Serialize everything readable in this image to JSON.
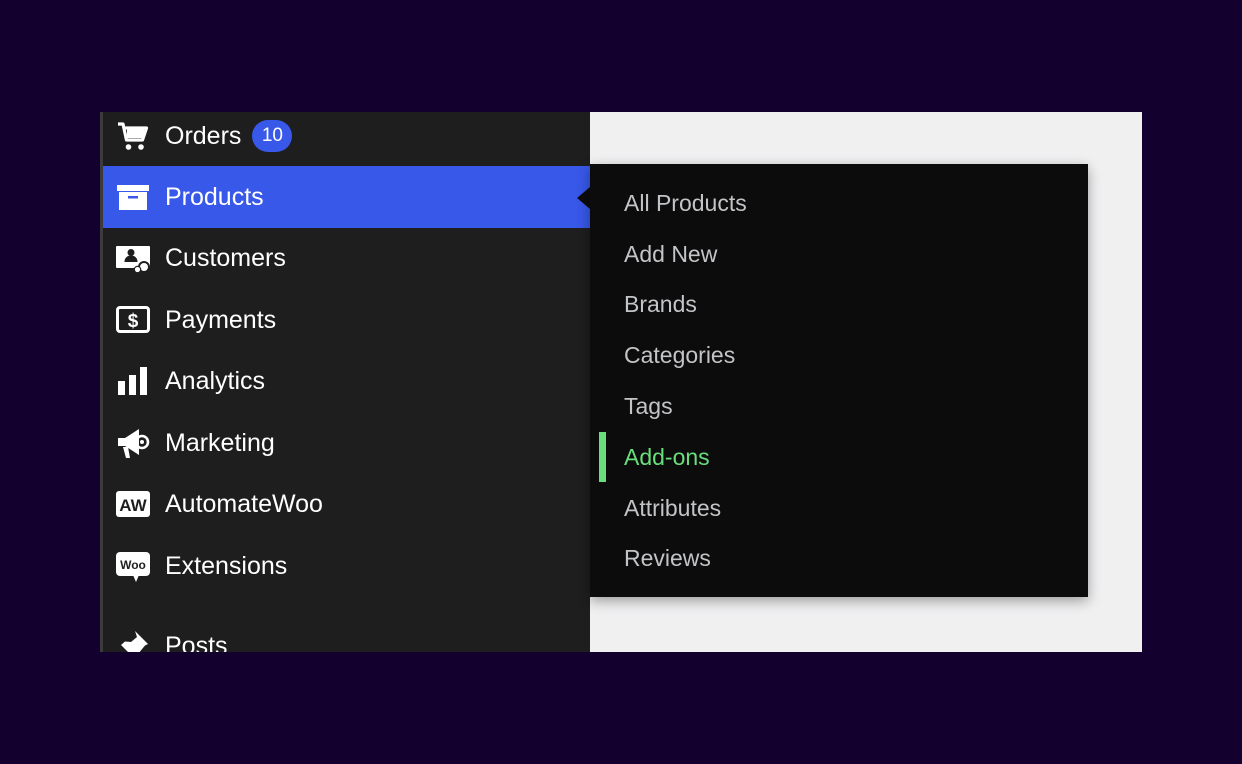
{
  "colors": {
    "background": "#13002f",
    "sidebar": "#1e1e1e",
    "active": "#3858e9",
    "submenu": "#0c0c0c",
    "submenu_text": "#c3c4c7",
    "current_submenu_text": "#68de7c",
    "content": "#f0f0f1"
  },
  "sidebar": {
    "items": [
      {
        "label": "Orders",
        "icon": "cart-icon",
        "badge": "10"
      },
      {
        "label": "Products",
        "icon": "archive-box-icon",
        "active": true
      },
      {
        "label": "Customers",
        "icon": "customers-icon"
      },
      {
        "label": "Payments",
        "icon": "dollar-icon"
      },
      {
        "label": "Analytics",
        "icon": "bar-chart-icon"
      },
      {
        "label": "Marketing",
        "icon": "megaphone-icon"
      },
      {
        "label": "AutomateWoo",
        "icon": "automatewoo-icon",
        "icon_text": "AW"
      },
      {
        "label": "Extensions",
        "icon": "woo-icon",
        "icon_text": "Woo"
      },
      {
        "label": "Posts",
        "icon": "pushpin-icon"
      }
    ]
  },
  "submenu": {
    "items": [
      {
        "label": "All Products"
      },
      {
        "label": "Add New"
      },
      {
        "label": "Brands"
      },
      {
        "label": "Categories"
      },
      {
        "label": "Tags"
      },
      {
        "label": "Add-ons",
        "current": true
      },
      {
        "label": "Attributes"
      },
      {
        "label": "Reviews"
      }
    ]
  }
}
